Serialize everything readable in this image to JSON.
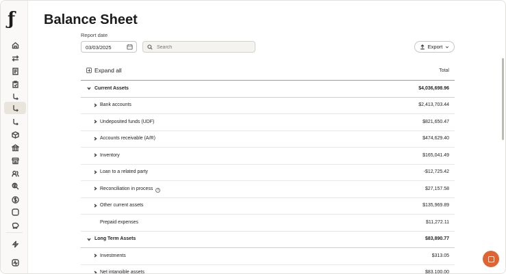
{
  "page": {
    "title": "Balance Sheet"
  },
  "filters": {
    "report_date_label": "Report date",
    "report_date_value": "03/03/2025",
    "search_placeholder": "Search",
    "export_label": "Export"
  },
  "table": {
    "expand_all_label": "Expand all",
    "total_header": "Total",
    "rows": [
      {
        "label": "Current Assets",
        "amount": "$4,036,698.96",
        "type": "section",
        "state": "expanded"
      },
      {
        "label": "Bank accounts",
        "amount": "$2,413,703.44",
        "type": "item",
        "state": "collapsed"
      },
      {
        "label": "Undeposited funds (UDF)",
        "amount": "$821,650.47",
        "type": "item",
        "state": "collapsed"
      },
      {
        "label": "Accounts receivable (A/R)",
        "amount": "$474,629.40",
        "type": "item",
        "state": "collapsed"
      },
      {
        "label": "Inventory",
        "amount": "$165,041.49",
        "type": "item",
        "state": "collapsed"
      },
      {
        "label": "Loan to a related party",
        "amount": "-$12,725.42",
        "type": "item",
        "state": "collapsed"
      },
      {
        "label": "Reconciliation in process",
        "amount": "$27,157.58",
        "type": "item",
        "state": "collapsed",
        "info": true
      },
      {
        "label": "Other current assets",
        "amount": "$135,969.89",
        "type": "item",
        "state": "collapsed"
      },
      {
        "label": "Prepaid expenses",
        "amount": "$11,272.11",
        "type": "leaf",
        "state": "none"
      },
      {
        "label": "Long Term Assets",
        "amount": "$83,890.77",
        "type": "section",
        "state": "expanded"
      },
      {
        "label": "Investments",
        "amount": "$313.05",
        "type": "item",
        "state": "collapsed"
      },
      {
        "label": "Net intangible assets",
        "amount": "$83,100.00",
        "type": "item",
        "state": "collapsed"
      }
    ]
  },
  "sidebar": {
    "items": [
      {
        "icon": "home-icon",
        "active": false
      },
      {
        "icon": "transfer-icon",
        "active": false
      },
      {
        "icon": "receipt-icon",
        "active": false
      },
      {
        "icon": "clipboard-icon",
        "active": false
      },
      {
        "icon": "branch-icon",
        "active": false
      },
      {
        "icon": "branch-icon",
        "active": true
      },
      {
        "icon": "branch-icon",
        "active": false
      },
      {
        "icon": "box-icon",
        "active": false
      },
      {
        "icon": "bank-icon",
        "active": false
      },
      {
        "icon": "store-icon",
        "active": false
      },
      {
        "icon": "users-icon",
        "active": false
      },
      {
        "icon": "user-search-icon",
        "active": false
      },
      {
        "icon": "dollar-icon",
        "active": false
      },
      {
        "icon": "more-icon",
        "active": false
      },
      {
        "icon": "piggy-bank-icon",
        "active": false
      },
      {
        "icon": "lightning-icon",
        "active": false
      },
      {
        "icon": "activity-icon",
        "active": false
      }
    ]
  },
  "colors": {
    "accent": "#e06432",
    "active_nav": "#e9e4dc"
  }
}
